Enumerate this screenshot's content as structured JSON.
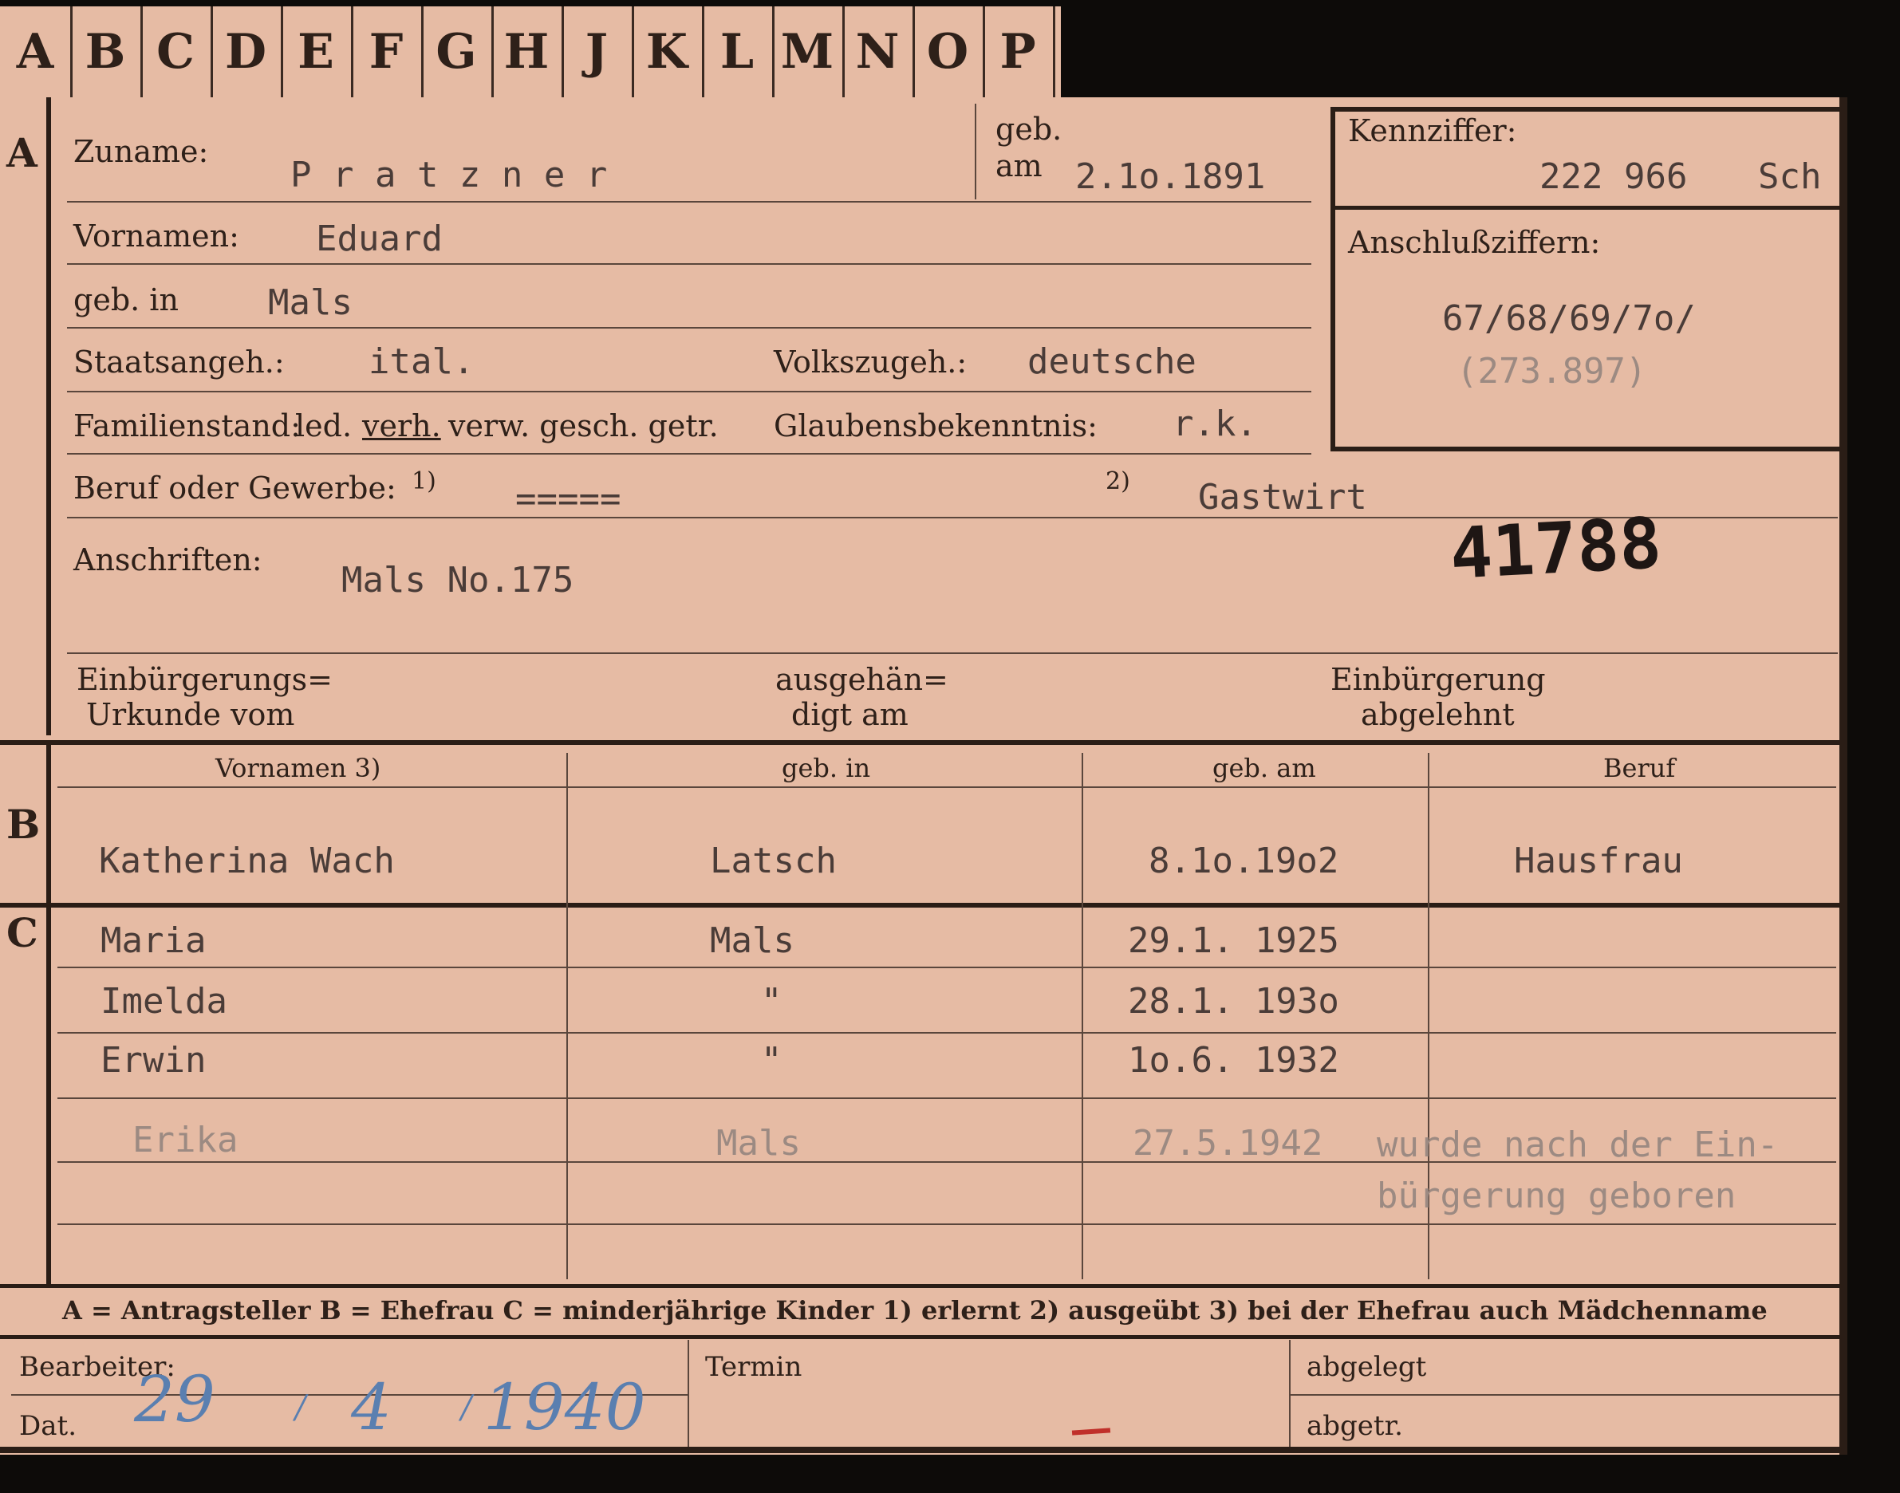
{
  "register_tabs": [
    "A",
    "B",
    "C",
    "D",
    "E",
    "F",
    "G",
    "H",
    "J",
    "K",
    "L",
    "M",
    "N",
    "O",
    "P"
  ],
  "section_a": {
    "marker": "A",
    "zuname_label": "Zuname:",
    "zuname_value": "P r a t z n e r",
    "geb_label": "geb.",
    "am_label": "am",
    "geb_am_value": "2.1o.1891",
    "vornamen_label": "Vornamen:",
    "vornamen_value": "Eduard",
    "geb_in_label": "geb. in",
    "geb_in_value": "Mals",
    "staatsangeh_label": "Staatsangeh.:",
    "staatsangeh_value": "ital.",
    "volkszugeh_label": "Volkszugeh.:",
    "volkszugeh_value": "deutsche",
    "familienstand_label": "Familienstand:",
    "familienstand_opt1": "led.",
    "familienstand_opt2": "verh.",
    "familienstand_opt3": "verw. gesch. getr.",
    "glaubens_label": "Glaubensbekenntnis:",
    "glaubens_value": "r.k.",
    "beruf_label": "Beruf oder Gewerbe:",
    "beruf_note1": "1)",
    "beruf_value1": "=====",
    "beruf_note2": "2)",
    "beruf_value2": "Gastwirt",
    "anschriften_label": "Anschriften:",
    "anschriften_value": "Mals No.175",
    "stamp_number": "41788",
    "einb_urkunde_label_1": "Einbürgerungs=",
    "einb_urkunde_label_2": "Urkunde vom",
    "ausgehaendigt_label_1": "ausgehän=",
    "ausgehaendigt_label_2": "digt am",
    "einb_abgelehnt_label_1": "Einbürgerung",
    "einb_abgelehnt_label_2": "abgelehnt"
  },
  "right_box": {
    "kennziffer_label": "Kennziffer:",
    "kennziffer_value": "222 966",
    "kennziffer_suffix": "Sch",
    "anschluss_label": "Anschlußziffern:",
    "anschluss_value": "67/68/69/7o/",
    "anschluss_extra": "(273.897)"
  },
  "section_b": {
    "marker": "B",
    "headers": [
      "Vornamen 3)",
      "geb. in",
      "geb. am",
      "Beruf"
    ],
    "row": {
      "name": "Katherina  Wach",
      "place": "Latsch",
      "date": "8.1o.19o2",
      "beruf": "Hausfrau"
    }
  },
  "section_c": {
    "marker": "C",
    "rows": [
      {
        "name": "Maria",
        "place": "Mals",
        "date": "29.1. 1925"
      },
      {
        "name": "Imelda",
        "place": "\"",
        "date": "28.1. 193o"
      },
      {
        "name": "Erwin",
        "place": "\"",
        "date": "1o.6. 1932"
      },
      {
        "name": "Erika",
        "place": "Mals",
        "date": "27.5.1942"
      }
    ],
    "note_line1": "wurde nach der Ein-",
    "note_line2": "bürgerung geboren"
  },
  "legend": {
    "text": "A = Antragsteller   B = Ehefrau   C = minderjährige Kinder   1) erlernt   2) ausgeübt   3) bei der Ehefrau auch Mädchenname"
  },
  "footer": {
    "bearbeiter_label": "Bearbeiter:",
    "dat_label": "Dat.",
    "date_day": "29",
    "date_month": "4",
    "date_year": "1940",
    "termin_label": "Termin",
    "abgelegt_label": "abgelegt",
    "abgetr_label": "abgetr."
  }
}
